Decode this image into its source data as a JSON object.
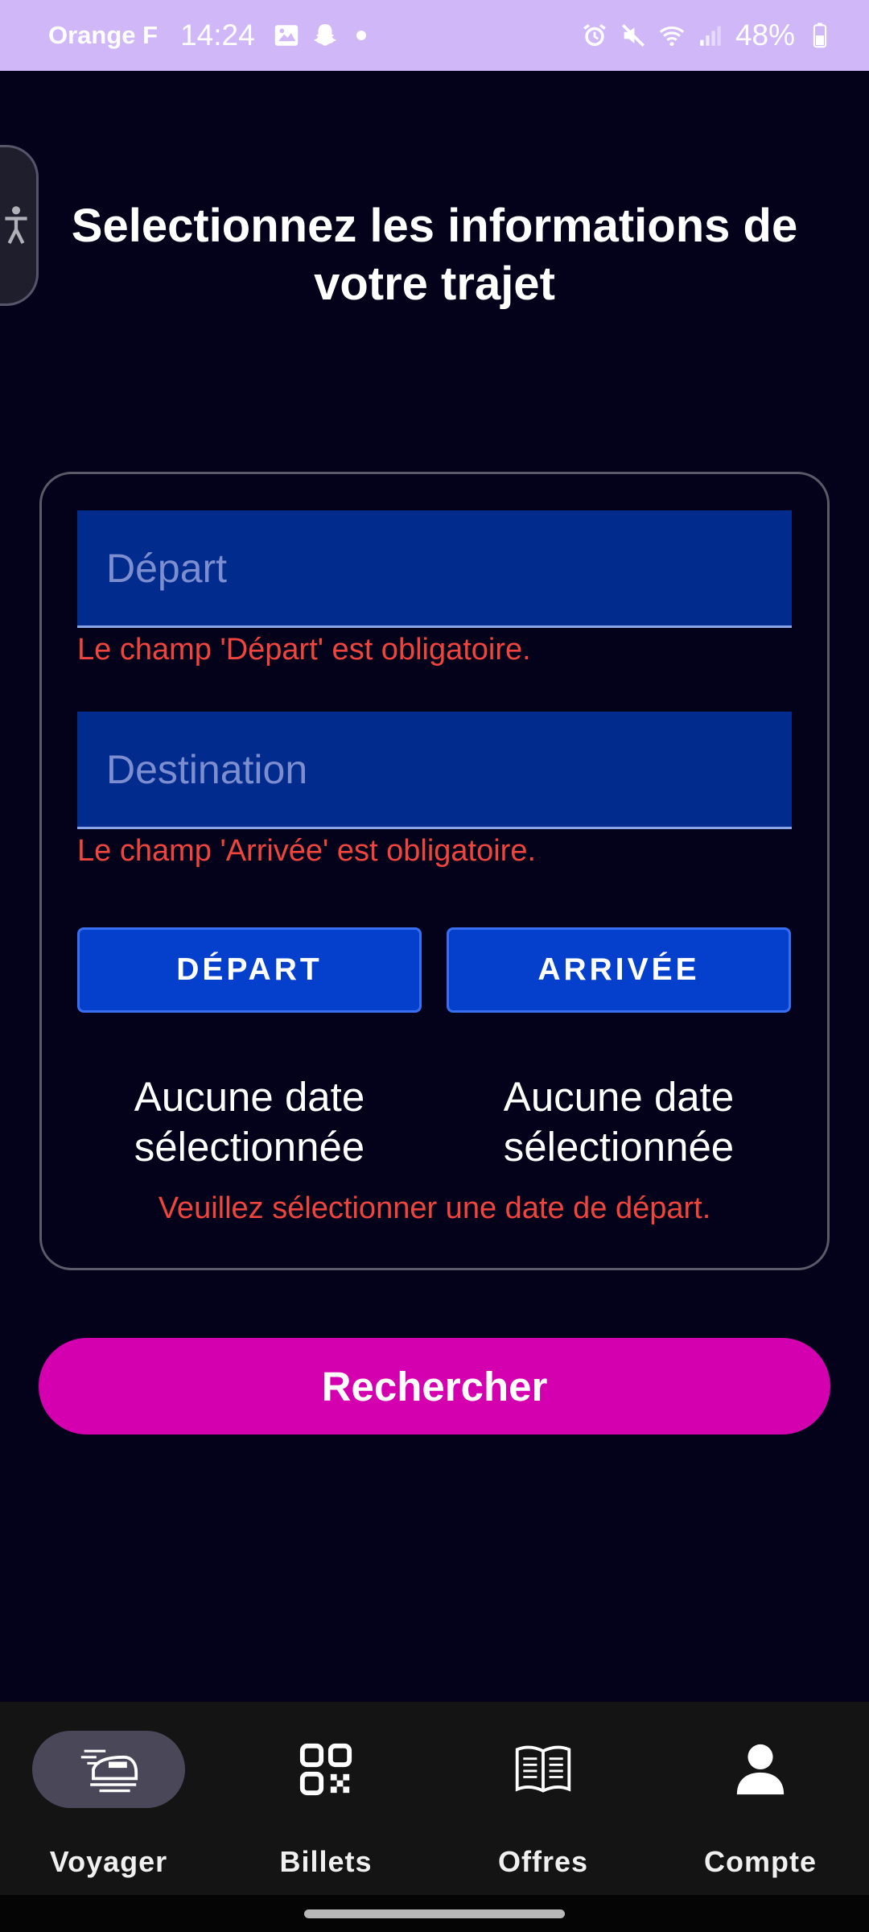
{
  "status_bar": {
    "carrier": "Orange F",
    "time": "14:24",
    "battery": "48%",
    "icons": [
      "gallery-icon",
      "snapchat-icon",
      "alarm-icon",
      "mute-icon",
      "wifi-icon",
      "signal-icon",
      "battery-icon"
    ]
  },
  "page": {
    "title": "Selectionnez les informations de votre trajet"
  },
  "form": {
    "departure_input": {
      "placeholder": "Départ",
      "value": ""
    },
    "departure_error": "Le champ 'Départ' est obligatoire.",
    "destination_input": {
      "placeholder": "Destination",
      "value": ""
    },
    "destination_error": "Le champ 'Arrivée' est obligatoire.",
    "departure_date_button": "DÉPART",
    "arrival_date_button": "ARRIVÉE",
    "departure_date_value_line1": "Aucune date",
    "departure_date_value_line2": "sélectionnée",
    "arrival_date_value_line1": "Aucune date",
    "arrival_date_value_line2": "sélectionnée",
    "date_error": "Veuillez sélectionner une date de départ."
  },
  "search_button": "Rechercher",
  "bottom_nav": {
    "items": [
      {
        "label": "Voyager",
        "icon": "train-icon",
        "active": true
      },
      {
        "label": "Billets",
        "icon": "qr-code-icon",
        "active": false
      },
      {
        "label": "Offres",
        "icon": "book-icon",
        "active": false
      },
      {
        "label": "Compte",
        "icon": "person-icon",
        "active": false
      }
    ]
  },
  "colors": {
    "background": "#03021a",
    "status_bar": "#d0b8f8",
    "input_bg": "#022b8e",
    "button_blue": "#0440cc",
    "error": "#f0443e",
    "search_button": "#d400b0",
    "nav_bg": "#141414",
    "nav_active_pill": "#4a4858"
  }
}
